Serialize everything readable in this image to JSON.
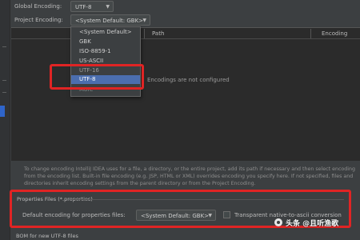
{
  "global_encoding": {
    "label": "Global Encoding:",
    "value": "UTF-8"
  },
  "project_encoding": {
    "label": "Project Encoding:",
    "value": "<System Default: GBK>"
  },
  "table": {
    "col_path": "Path",
    "col_encoding": "Encoding",
    "empty_text": "Encodings are not configured"
  },
  "dropdown": {
    "options": [
      "<System Default>",
      "GBK",
      "ISO-8859-1",
      "US-ASCII",
      "UTF-16",
      "UTF-8",
      "More"
    ],
    "selected": "UTF-8"
  },
  "description": "To change encoding IntelliJ IDEA uses for a file, a directory, or the entire project, add its path if necessary and then select encoding from the encoding list. Built-in file encoding (e.g. JSP, HTML or XML) overrides encoding you specify here. If not specified, files and directories inherit encoding settings from the parent directory or from the Project Encoding.",
  "properties_files": {
    "group_title": "Properties Files (*.properties)",
    "default_label": "Default encoding for properties files:",
    "default_value": "<System Default: GBK>",
    "transparent_label": "Transparent native-to-ascii conversion",
    "transparent_checked": false
  },
  "bom_label": "BOM for new UTF-8 files",
  "watermark": "头条 @且听渔歌",
  "colors": {
    "background": "#3c3f41",
    "selection": "#4b6eaf",
    "highlight_box": "#e02424"
  }
}
